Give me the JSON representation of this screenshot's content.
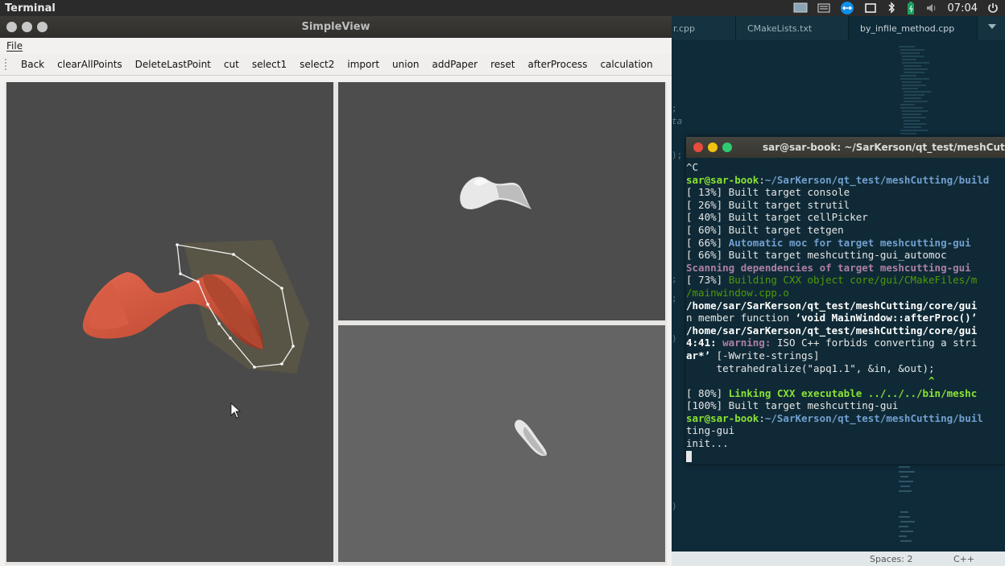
{
  "topbar": {
    "title": "Terminal",
    "clock": "07:04"
  },
  "window": {
    "title": "SimpleView",
    "menu": [
      "File"
    ],
    "toolbar": [
      "Back",
      "clearAllPoints",
      "DeleteLastPoint",
      "cut",
      "select1",
      "select2",
      "import",
      "union",
      "addPaper",
      "reset",
      "afterProcess",
      "calculation"
    ]
  },
  "editor": {
    "tabs": [
      {
        "label": "r.cpp",
        "modified": true
      },
      {
        "label": "CMakeLists.txt",
        "modified": false
      },
      {
        "label": "by_infile_method.cpp",
        "modified": false
      }
    ],
    "gutter": [
      ";",
      "ta",
      ");",
      ";",
      ";",
      ")",
      ")"
    ],
    "status": {
      "spaces": "Spaces: 2",
      "lang": "C++"
    }
  },
  "terminal": {
    "title": "sar@sar-book: ~/SarKerson/qt_test/meshCutting/build",
    "lines": [
      [
        {
          "t": "^C",
          "c": ""
        }
      ],
      [
        {
          "t": "sar@sar-book",
          "c": "g"
        },
        {
          "t": ":",
          "c": ""
        },
        {
          "t": "~/SarKerson/qt_test/meshCutting/build",
          "c": "b"
        }
      ],
      [
        {
          "t": "[ 13%] Built target console",
          "c": ""
        }
      ],
      [
        {
          "t": "[ 26%] Built target strutil",
          "c": ""
        }
      ],
      [
        {
          "t": "[ 40%] Built target cellPicker",
          "c": ""
        }
      ],
      [
        {
          "t": "[ 60%] Built target tetgen",
          "c": ""
        }
      ],
      [
        {
          "t": "[ 66%] ",
          "c": ""
        },
        {
          "t": "Automatic moc for target meshcutting-gui",
          "c": "b"
        }
      ],
      [
        {
          "t": "[ 66%] Built target meshcutting-gui_automoc",
          "c": ""
        }
      ],
      [
        {
          "t": "Scanning dependencies of target meshcutting-gui",
          "c": "mg"
        }
      ],
      [
        {
          "t": "[ 73%] ",
          "c": ""
        },
        {
          "t": "Building CXX object core/gui/CMakeFiles/m",
          "c": "gr"
        }
      ],
      [
        {
          "t": "/mainwindow.cpp.o",
          "c": "gr"
        }
      ],
      [
        {
          "t": "/home/sar/SarKerson/qt_test/meshCutting/core/gui",
          "c": "w"
        }
      ],
      [
        {
          "t": "n member function ",
          "c": ""
        },
        {
          "t": "‘void MainWindow::afterProc()’",
          "c": "w"
        }
      ],
      [
        {
          "t": "/home/sar/SarKerson/qt_test/meshCutting/core/gui",
          "c": "w"
        }
      ],
      [
        {
          "t": "4:41: ",
          "c": "w"
        },
        {
          "t": "warning: ",
          "c": "mg"
        },
        {
          "t": "ISO C++ forbids converting a stri",
          "c": ""
        }
      ],
      [
        {
          "t": "ar*’",
          "c": "w"
        },
        {
          "t": " [-Wwrite-strings]",
          "c": ""
        }
      ],
      [
        {
          "t": "     tetrahedralize(\"apq1.1\", &in, &out);",
          "c": ""
        }
      ],
      [
        {
          "t": "                                        ^",
          "c": "gb"
        }
      ],
      [
        {
          "t": "[ 80%] ",
          "c": ""
        },
        {
          "t": "Linking CXX executable ../../../bin/meshc",
          "c": "gb"
        }
      ],
      [
        {
          "t": "[100%] Built target meshcutting-gui",
          "c": ""
        }
      ],
      [
        {
          "t": "sar@sar-book",
          "c": "g"
        },
        {
          "t": ":",
          "c": ""
        },
        {
          "t": "~/SarKerson/qt_test/meshCutting/buil",
          "c": "b"
        }
      ],
      [
        {
          "t": "ting-gui",
          "c": ""
        }
      ],
      [
        {
          "t": "init...",
          "c": ""
        }
      ]
    ]
  }
}
